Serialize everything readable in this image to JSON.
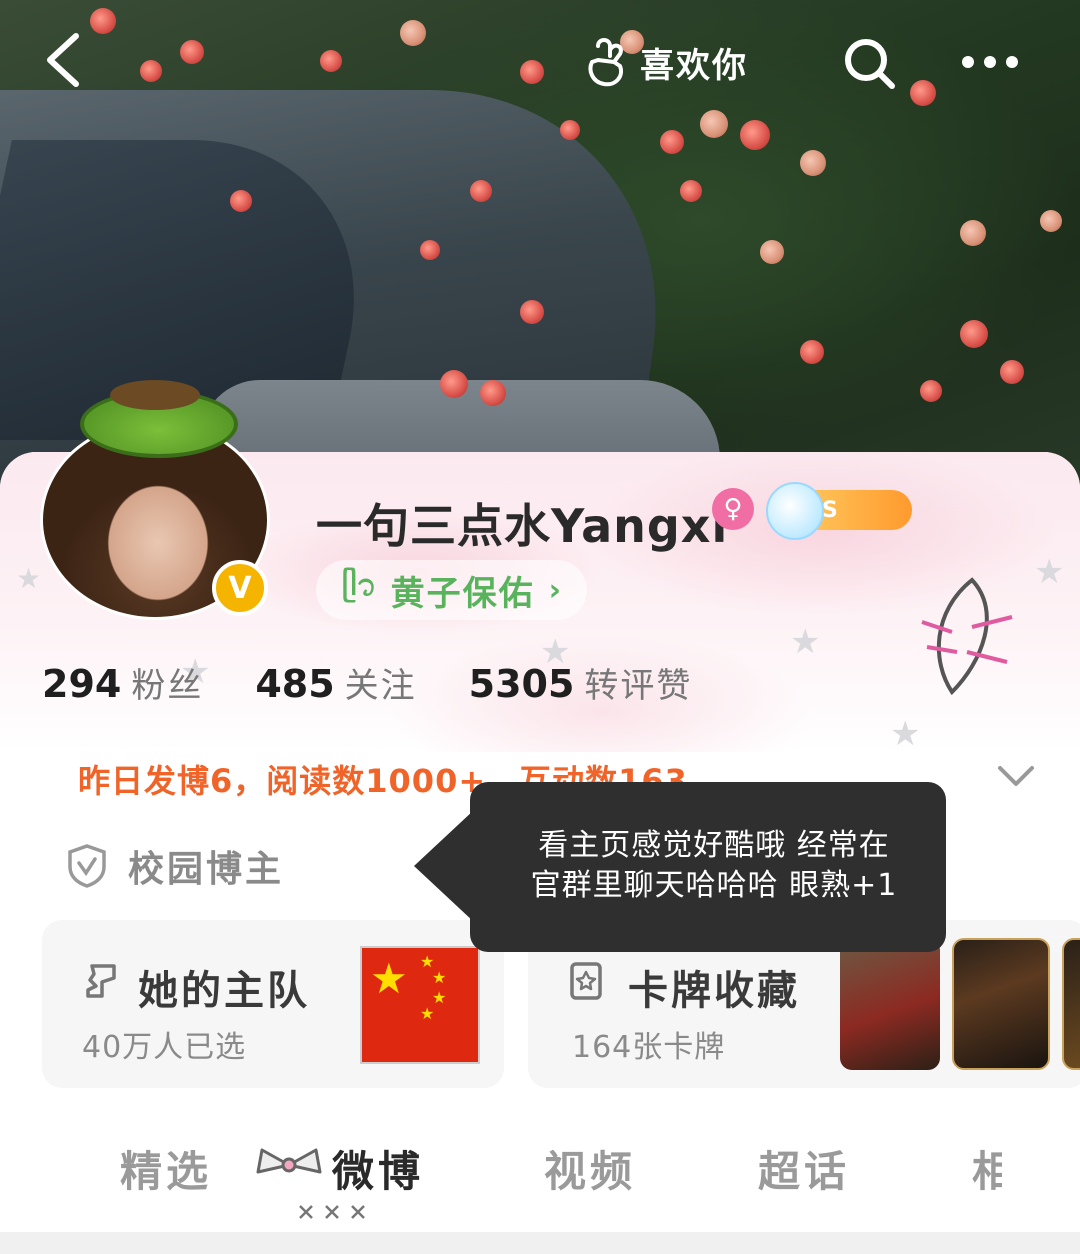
{
  "header": {
    "like_label": "喜欢你"
  },
  "profile": {
    "username": "一句三点水Yangxi",
    "gender_symbol": "♀",
    "level_text": "S",
    "tag_icon": "ᥫ᭡",
    "tag_label": "黄子保佑",
    "tag_chevron": "›",
    "verified_symbol": "V"
  },
  "stats": [
    {
      "value": "294",
      "label": "粉丝"
    },
    {
      "value": "485",
      "label": "关注"
    },
    {
      "value": "5305",
      "label": "转评赞"
    }
  ],
  "daily_summary": "昨日发博6，阅读数1000+，互动数163",
  "campus_label": "校园博主",
  "tooltip": {
    "line1": "看主页感觉好酷哦 经常在",
    "line2": "官群里聊天哈哈哈 眼熟+1"
  },
  "team_card": {
    "title": "她的主队",
    "subtitle": "40万人已选"
  },
  "collection_card": {
    "title": "卡牌收藏",
    "subtitle": "164张卡牌"
  },
  "tabs": [
    {
      "label": "精选",
      "active": false
    },
    {
      "label": "微博",
      "active": true
    },
    {
      "label": "视频",
      "active": false
    },
    {
      "label": "超话",
      "active": false
    },
    {
      "label": "相",
      "active": false
    }
  ],
  "colors": {
    "accent_orange": "#f0642a",
    "tag_green": "#59b35c",
    "verified_gold": "#f4b400",
    "gender_pink": "#f06ea4",
    "tooltip_bg": "#2f2f2f"
  }
}
